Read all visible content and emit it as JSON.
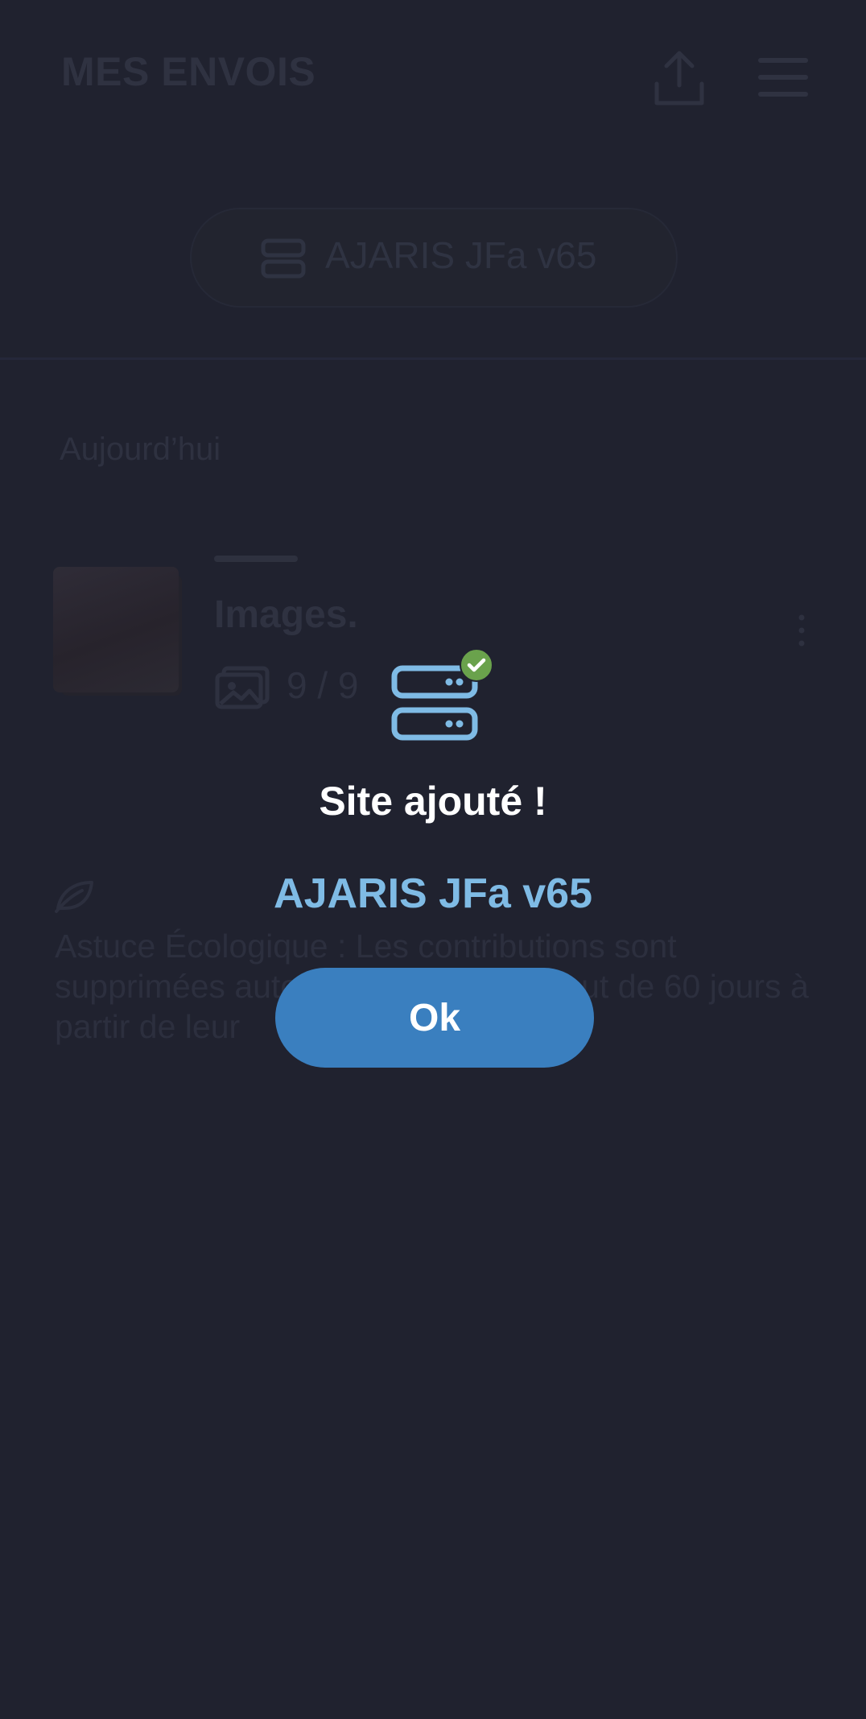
{
  "header": {
    "title": "MES ENVOIS",
    "upload_icon": "upload-icon",
    "menu_icon": "hamburger-menu-icon"
  },
  "site_selector": {
    "icon": "server-icon",
    "label": "AJARIS JFa v65"
  },
  "uploads": {
    "section_label": "Aujourd’hui",
    "items": [
      {
        "title": "Images.",
        "count": "9 / 9",
        "count_icon": "image-icon",
        "more_icon": "kebab-menu-icon"
      }
    ]
  },
  "tip": {
    "icon": "leaf-icon",
    "text": "Astuce Écologique : Les contributions sont supprimées automatiquement au bout de 60 jours à partir de leur"
  },
  "dialog": {
    "icon": "server-check-icon",
    "title": "Site ajouté !",
    "site_name": "AJARIS JFa v65",
    "ok_label": "Ok"
  },
  "colors": {
    "background": "#20222f",
    "accent": "#3a7fbf",
    "site_name": "#7fbbe5",
    "success": "#6aa24c"
  }
}
